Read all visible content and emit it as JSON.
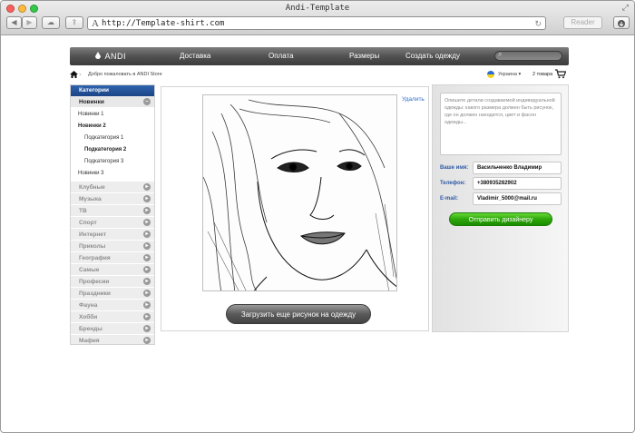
{
  "window": {
    "title": "Andi-Template"
  },
  "toolbar": {
    "url": "http://Template-shirt.com",
    "reader": "Reader",
    "url_prefix": "A"
  },
  "nav": {
    "logo": "ANDI",
    "items": [
      "Доставка",
      "Оплата",
      "Размеры",
      "Создать одежду"
    ]
  },
  "subbar": {
    "welcome": "Добро пожаловать в ANDI Store",
    "country": "Украина",
    "cart": "2 товара"
  },
  "sidebar": {
    "header": "Категории",
    "open_category": "Новинки",
    "subitems": [
      {
        "label": "Новинки 1",
        "level": 1,
        "bold": false
      },
      {
        "label": "Новинки 2",
        "level": 1,
        "bold": true
      },
      {
        "label": "Подкатегория 1",
        "level": 2,
        "bold": false
      },
      {
        "label": "Подкатегория 2",
        "level": 2,
        "bold": true
      },
      {
        "label": "Подкатегория 3",
        "level": 2,
        "bold": false
      },
      {
        "label": "Новинки 3",
        "level": 1,
        "bold": false
      }
    ],
    "categories": [
      "Клубные",
      "Музыка",
      "ТВ",
      "Спорт",
      "Интернет",
      "Приколы",
      "География",
      "Самые",
      "Професии",
      "Праздники",
      "Фауна",
      "Хобби",
      "Бренды",
      "Мафия"
    ]
  },
  "editor": {
    "delete_label": "Удалить",
    "upload_button": "Загрузить еще рисунок на одежду"
  },
  "form": {
    "details_placeholder": "Опишите детали создаваемой индивидуальной одежды: какого размера должен быть рисунок, где он должен находится, цвет и фасон одежды...",
    "name_label": "Ваше имя:",
    "name_value": "Васильченко Владимир",
    "phone_label": "Телефон:",
    "phone_value": "+380935282902",
    "email_label": "E-mail:",
    "email_value": "Vladimir_5000@mail.ru",
    "submit": "Отправить дизайнеру"
  },
  "colors": {
    "accent_blue": "#1b4586",
    "link": "#2f6ec9",
    "submit_green": "#2ea70a",
    "nav_dark": "#4a4a4a"
  },
  "icons": [
    "back-icon",
    "forward-icon",
    "cloud-icon",
    "share-icon",
    "reload-icon",
    "download-icon",
    "search-icon",
    "home-icon",
    "flag-icon",
    "cart-icon"
  ]
}
